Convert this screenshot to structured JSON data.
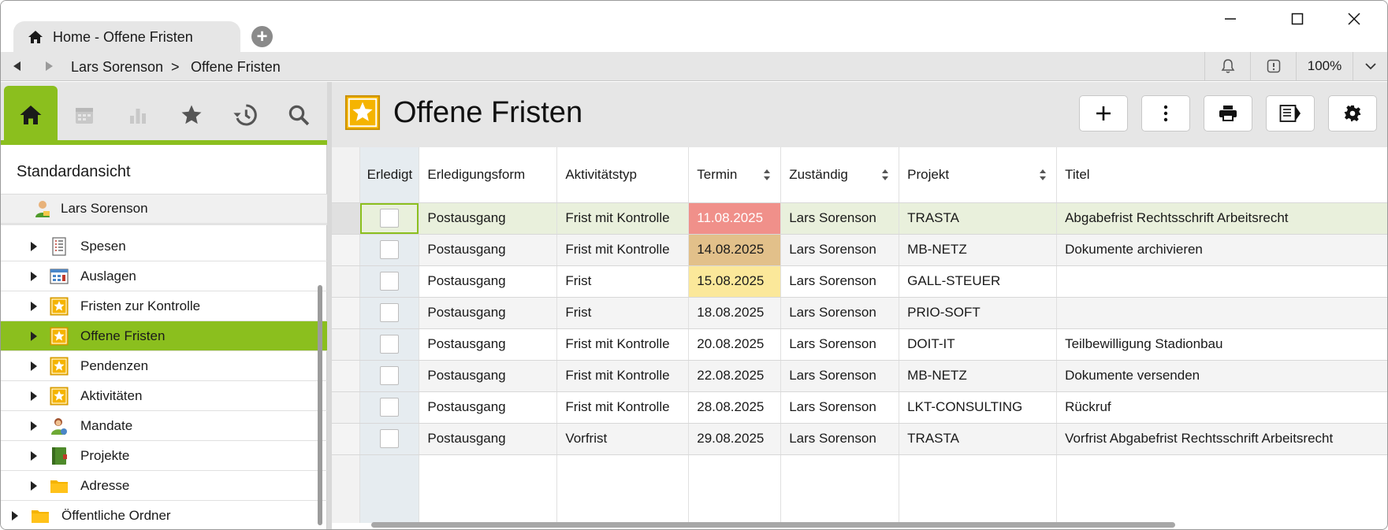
{
  "window": {
    "tab_title": "Home - Offene Fristen",
    "new_tab_icon": "plus-circle-icon"
  },
  "breadcrumb": {
    "items": [
      "Lars Sorenson",
      ">",
      "Offene Fristen"
    ],
    "zoom": "100%"
  },
  "sidebar": {
    "icons": [
      "home-icon",
      "calendar-icon",
      "chart-icon",
      "star-icon",
      "history-icon",
      "search-icon"
    ],
    "view_label": "Standardansicht",
    "user": "Lars Sorenson",
    "items": [
      {
        "label": "Spesen",
        "icon": "receipt-icon"
      },
      {
        "label": "Auslagen",
        "icon": "calculator-icon"
      },
      {
        "label": "Fristen zur Kontrolle",
        "icon": "star-icon"
      },
      {
        "label": "Offene Fristen",
        "icon": "star-icon",
        "selected": true
      },
      {
        "label": "Pendenzen",
        "icon": "star-icon"
      },
      {
        "label": "Aktivitäten",
        "icon": "star-icon"
      },
      {
        "label": "Mandate",
        "icon": "person-icon"
      },
      {
        "label": "Projekte",
        "icon": "book-icon"
      },
      {
        "label": "Adresse",
        "icon": "folder-icon"
      }
    ],
    "root_item": {
      "label": "Öffentliche Ordner",
      "icon": "folder-icon"
    }
  },
  "main": {
    "title": "Offene Fristen",
    "toolbar": [
      "add-icon",
      "more-icon",
      "print-icon",
      "panel-icon",
      "settings-icon"
    ]
  },
  "table": {
    "columns": [
      "Erledigt",
      "Erledigungsform",
      "Aktivitätstyp",
      "Termin",
      "Zuständig",
      "Projekt",
      "Titel"
    ],
    "rows": [
      {
        "form": "Postausgang",
        "typ": "Frist mit Kontrolle",
        "termin": "11.08.2025",
        "zust": "Lars Sorenson",
        "projekt": "TRASTA",
        "titel": "Abgabefrist Rechtsschrift Arbeitsrecht",
        "termin_color": "#f0908a",
        "termin_text": "#ffffff"
      },
      {
        "form": "Postausgang",
        "typ": "Frist mit Kontrolle",
        "termin": "14.08.2025",
        "zust": "Lars Sorenson",
        "projekt": "MB-NETZ",
        "titel": "Dokumente archivieren",
        "termin_color": "#e2c08a",
        "termin_text": "#1a1a1a"
      },
      {
        "form": "Postausgang",
        "typ": "Frist",
        "termin": "15.08.2025",
        "zust": "Lars Sorenson",
        "projekt": "GALL-STEUER",
        "titel": "",
        "termin_color": "#fbe89a",
        "termin_text": "#1a1a1a"
      },
      {
        "form": "Postausgang",
        "typ": "Frist",
        "termin": "18.08.2025",
        "zust": "Lars Sorenson",
        "projekt": "PRIO-SOFT",
        "titel": ""
      },
      {
        "form": "Postausgang",
        "typ": "Frist mit Kontrolle",
        "termin": "20.08.2025",
        "zust": "Lars Sorenson",
        "projekt": "DOIT-IT",
        "titel": "Teilbewilligung Stadionbau"
      },
      {
        "form": "Postausgang",
        "typ": "Frist mit Kontrolle",
        "termin": "22.08.2025",
        "zust": "Lars Sorenson",
        "projekt": "MB-NETZ",
        "titel": "Dokumente versenden"
      },
      {
        "form": "Postausgang",
        "typ": "Frist mit Kontrolle",
        "termin": "28.08.2025",
        "zust": "Lars Sorenson",
        "projekt": "LKT-CONSULTING",
        "titel": "Rückruf"
      },
      {
        "form": "Postausgang",
        "typ": "Vorfrist",
        "termin": "29.08.2025",
        "zust": "Lars Sorenson",
        "projekt": "TRASTA",
        "titel": "Vorfrist Abgabefrist Rechtsschrift Arbeitsrecht"
      }
    ]
  },
  "colors": {
    "accent": "#8bbf1e",
    "star_tile": "#f5b400"
  }
}
